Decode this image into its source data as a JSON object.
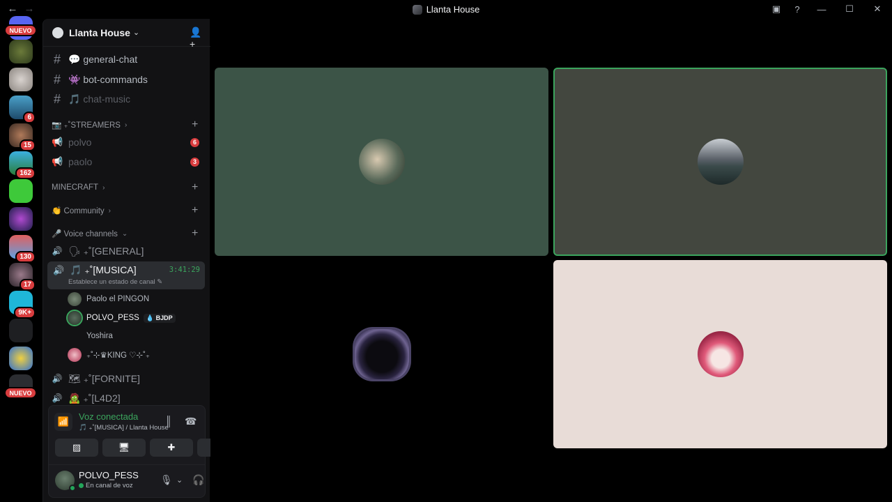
{
  "window": {
    "title": "Llanta House",
    "back_icon": "←",
    "forward_icon": "→",
    "minimize": "—",
    "maximize": "☐",
    "close": "✕",
    "inbox_icon": "▣",
    "help_icon": "?"
  },
  "servers": {
    "nuevo_top": "NUEVO",
    "nuevo_bottom": "NUEVO",
    "badges": [
      "6",
      "15",
      "162",
      "130",
      "17",
      "9K+"
    ]
  },
  "guild": {
    "name": "Llanta House",
    "chevron": "⌄",
    "invite_icon": "👤+"
  },
  "channels": {
    "general_chat": "💬 general-chat",
    "bot_commands": "👾 bot-commands",
    "chat_music": "🎵 chat-music",
    "streamers_cat": "📷 ₊˚STREAMERS",
    "polvo": "polvo",
    "polvo_unread": "6",
    "paolo": "paolo",
    "paolo_unread": "3",
    "minecraft_cat": "MINECRAFT",
    "community_cat": "👏 Community",
    "voice_cat": "🎤 Voice channels",
    "general_voice": "🗣 ₊˚[GENERAL]",
    "musica_voice": "🎵 ₊˚[MUSICA]",
    "musica_timer": "3:41:29",
    "musica_status": "Establece un estado de canal ✎",
    "fornite_voice": "🗺 ₊˚[FORNITE]",
    "l4d2_voice": "🧟 ₊˚[L4D2]",
    "hash": "#",
    "plus": "+",
    "cat_chev": "›",
    "speaker": "🔊"
  },
  "members": [
    {
      "name": "Paolo el PINGON",
      "tag": ""
    },
    {
      "name": "POLVO_PESS",
      "tag": "💧 BJDP"
    },
    {
      "name": "Yoshira",
      "tag": ""
    },
    {
      "name": "₊˚⊹♛KING ♡⊹˚₊",
      "tag": ""
    }
  ],
  "voice_panel": {
    "title": "Voz conectada",
    "subtitle": "🎵 ₊˚[MUSICA] / Llanta House",
    "signal_icon": "📶",
    "noise_icon": "║",
    "disconnect_icon": "☎",
    "camera_off": "▨",
    "share_screen": "🖥",
    "activities": "✚",
    "soundboard": "✺"
  },
  "user": {
    "name": "POLVO_PESS",
    "status": "En canal de voz",
    "mic_icon": "🎙",
    "headset_icon": "🎧",
    "settings_icon": "⚙",
    "chevron": "⌄"
  },
  "colors": {
    "accent_green": "#3ba55d",
    "badge_red": "#d83c3e",
    "tile1": "#3c5447",
    "tile2": "#43473f",
    "tile4": "#e8dcd7"
  }
}
